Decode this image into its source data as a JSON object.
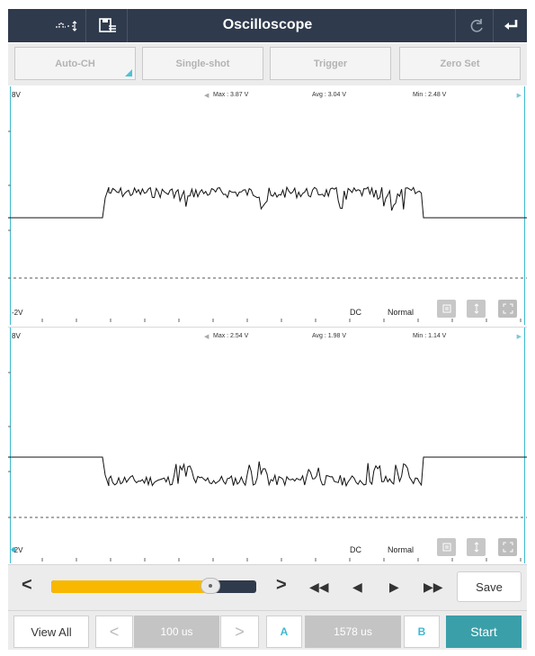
{
  "app": {
    "title": "Oscilloscope"
  },
  "modes": {
    "auto_ch": "Auto-CH",
    "single_shot": "Single-shot",
    "trigger": "Trigger",
    "zero_set": "Zero Set"
  },
  "channel1": {
    "top_label": "8V",
    "bottom_label": "-2V",
    "max": "Max : 3.87 V",
    "avg": "Avg : 3.04 V",
    "min": "Min : 2.48 V",
    "coupling": "DC",
    "mode": "Normal"
  },
  "channel2": {
    "top_label": "8V",
    "bottom_label": "-2V",
    "max": "Max : 2.54 V",
    "avg": "Avg : 1.98 V",
    "min": "Min : 1.14 V",
    "coupling": "DC",
    "mode": "Normal"
  },
  "controls": {
    "prev": "<",
    "next": ">",
    "save": "Save",
    "timeline_progress": 0.78
  },
  "bottom": {
    "view_all": "View All",
    "timebase": "100 us",
    "cursor_a": "A",
    "cursor_value": "1578 us",
    "cursor_b": "B",
    "start": "Start"
  },
  "colors": {
    "titlebar": "#2f3a4c",
    "accent": "#3fb9cf",
    "start": "#3a9fa8",
    "slider": "#f8b800"
  }
}
